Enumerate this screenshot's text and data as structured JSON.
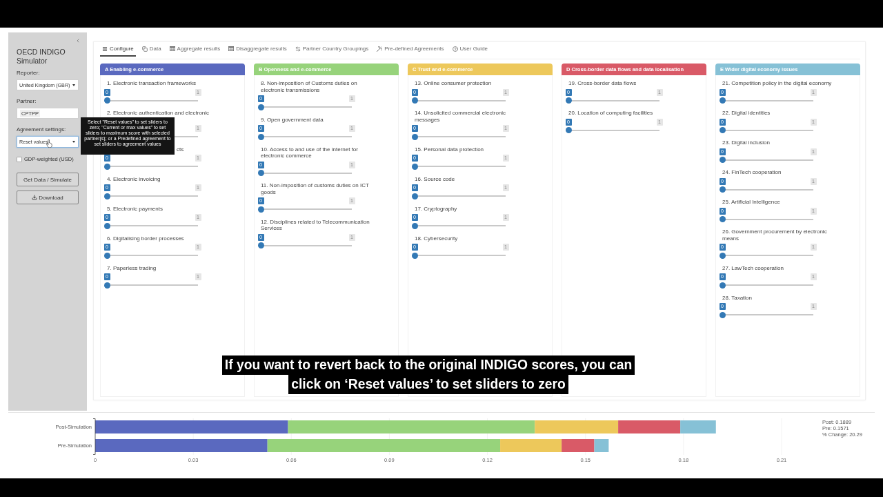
{
  "sidebar": {
    "title": "OECD INDIGO Simulator",
    "fields": [
      {
        "kind": "select",
        "label": "Reporter:",
        "value": "United Kingdom (GBR)",
        "focused": false
      },
      {
        "kind": "tags",
        "label": "Partner:",
        "tags": [
          "CPTPP"
        ],
        "focused": false
      },
      {
        "kind": "select",
        "label": "Agreement settings:",
        "value": "Reset values",
        "focused": true
      }
    ],
    "checkbox": {
      "label": "GDP-weighted (USD)",
      "checked": false
    },
    "buttons": [
      {
        "kind": "plain",
        "label": "Get Data / Simulate"
      },
      {
        "kind": "download",
        "label": "Download"
      }
    ]
  },
  "tooltip": {
    "text": "Select \"Reset values\" to set sliders to zero; \"Current or max values\" to set sliders to maximum score with selected partner(s); or a Predefined agreement to set sliders to agreement values"
  },
  "tabs": [
    {
      "label": "Configure",
      "selected": true
    },
    {
      "label": "Data",
      "selected": false
    },
    {
      "label": "Aggregate results",
      "selected": false
    },
    {
      "label": "Disaggregate results",
      "selected": false
    },
    {
      "label": "Partner Country Groupings",
      "selected": false
    },
    {
      "label": "Pre-defined Agreements",
      "selected": false
    },
    {
      "label": "User Guide",
      "selected": false
    }
  ],
  "columns": [
    {
      "title": "A Enabling e-commerce",
      "color": "#5a69bf",
      "items": [
        {
          "kind": "slider",
          "label": "1. Electronic transaction frameworks",
          "value": "0",
          "max": "1",
          "level": 0
        },
        {
          "kind": "overlapped",
          "label": "2. Electronic authentication and electronic",
          "max": "1"
        },
        {
          "kind": "clipped",
          "label": "cts",
          "value": "0",
          "max": "1",
          "level": 0
        },
        {
          "kind": "slider",
          "label": "4. Electronic invoicing",
          "value": "0",
          "max": "1",
          "level": 0
        },
        {
          "kind": "slider",
          "label": "5. Electronic payments",
          "value": "0",
          "max": "1",
          "level": 0
        },
        {
          "kind": "slider",
          "label": "6. Digitalising border processes",
          "value": "0",
          "max": "1",
          "level": 0
        },
        {
          "kind": "slider",
          "label": "7. Paperless trading",
          "value": "0",
          "max": "1",
          "level": 0
        }
      ]
    },
    {
      "title": "B Openness and e-commerce",
      "color": "#97d37b",
      "items": [
        {
          "label": "8. Non-imposition of Customs duties on\nelectronic transmissions",
          "value": "0",
          "max": "1",
          "level": 0
        },
        {
          "label": "9. Open government data",
          "value": "0",
          "max": "1",
          "level": 0
        },
        {
          "label": "10. Access to and use of the internet for\nelectronic commerce",
          "value": "0",
          "max": "1",
          "level": 0
        },
        {
          "label": "11. Non-imposition of customs duties on ICT\ngoods",
          "value": "0",
          "max": "1",
          "level": 0
        },
        {
          "label": "12. Disciplines related to Telecommunication\nServices",
          "value": "0",
          "max": "1",
          "level": 0
        }
      ]
    },
    {
      "title": "C Trust and e-commerce",
      "color": "#edc85b",
      "items": [
        {
          "label": "13. Online consumer protection",
          "value": "0",
          "max": "1",
          "level": 0
        },
        {
          "label": "14. Unsolicited commercial electronic\nmessages",
          "value": "0",
          "max": "1",
          "level": 0
        },
        {
          "label": "15. Personal data protection",
          "value": "0",
          "max": "1",
          "level": 0
        },
        {
          "label": "16. Source code",
          "value": "0",
          "max": "1",
          "level": 0
        },
        {
          "label": "17. Cryptography",
          "value": "0",
          "max": "1",
          "level": 0
        },
        {
          "label": "18. Cybersecurity",
          "value": "0",
          "max": "1",
          "level": 0
        }
      ]
    },
    {
      "title": "D Cross-border data flows and data localisation",
      "color": "#d95a67",
      "items": [
        {
          "label": "19. Cross-border data flows",
          "value": "0",
          "max": "1",
          "level": 0
        },
        {
          "label": "20. Location of computing facilities",
          "value": "0",
          "max": "1",
          "level": 0
        }
      ]
    },
    {
      "title": "E Wider digital economy issues",
      "color": "#86c1d6",
      "items": [
        {
          "label": "21. Competition policy in the digital economy",
          "value": "0",
          "max": "1",
          "level": 0
        },
        {
          "label": "22. Digital identities",
          "value": "0",
          "max": "1",
          "level": 0
        },
        {
          "label": "23. Digital inclusion",
          "value": "0",
          "max": "1",
          "level": 0
        },
        {
          "label": "24. FinTech cooperation",
          "value": "0",
          "max": "1",
          "level": 0
        },
        {
          "label": "25. Artificial Intelligence",
          "value": "0",
          "max": "1",
          "level": 0
        },
        {
          "label": "26. Government procurement by electronic\nmeans",
          "value": "0",
          "max": "1",
          "level": 0
        },
        {
          "label": "27. LawTech cooperation",
          "value": "0",
          "max": "1",
          "level": 0
        },
        {
          "label": "28. Taxation",
          "value": "0",
          "max": "1",
          "level": 0
        }
      ]
    }
  ],
  "caption": [
    "If you want to revert back to the original INDIGO scores, you can",
    "click on ‘Reset values’ to set sliders to zero"
  ],
  "results": {
    "chart_data": [
      {
        "type": "bar",
        "orientation": "horizontal",
        "stacked": true,
        "categories": [
          "Post-Simulation",
          "Pre-Simulation"
        ],
        "series": [
          {
            "color": "#5a69bf",
            "values": [
              0.059,
              0.0527
            ]
          },
          {
            "color": "#97d37b",
            "values": [
              0.0755,
              0.0712
            ]
          },
          {
            "color": "#edc85b",
            "values": [
              0.0255,
              0.0188
            ]
          },
          {
            "color": "#d95a67",
            "values": [
              0.019,
              0.01
            ]
          },
          {
            "color": "#86c1d6",
            "values": [
              0.0109,
              0.0044
            ]
          }
        ],
        "xticks": [
          0,
          0.03,
          0.06,
          0.09,
          0.12,
          0.15,
          0.18,
          0.21
        ],
        "xlim": [
          0,
          0.21
        ],
        "grid": true,
        "annotations": [
          "Post: 0.1889",
          "Pre: 0.1571",
          "% Change: 20.29"
        ]
      }
    ]
  }
}
